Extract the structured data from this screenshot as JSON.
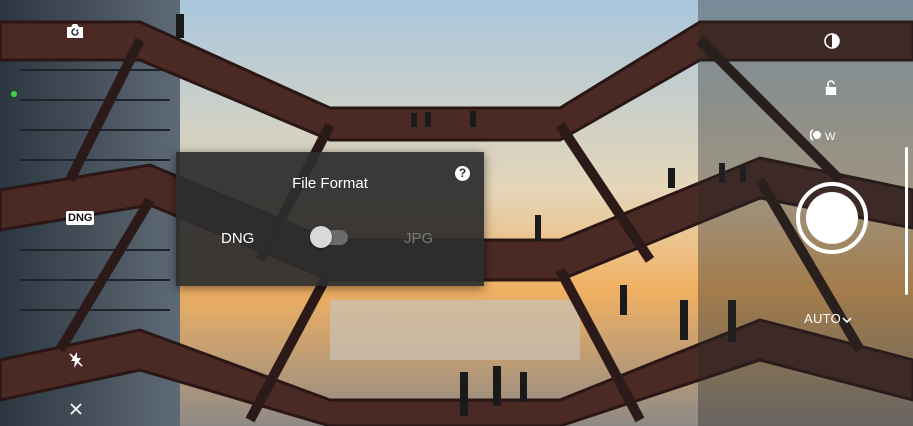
{
  "top_left": {
    "switch_camera_icon": "camera-switch-icon"
  },
  "badges": {
    "format_badge": "DNG"
  },
  "right_controls": {
    "filter_icon": "filter-icon",
    "lock_icon": "unlock-icon",
    "white_balance": {
      "icon": "wb-tungsten-icon",
      "suffix": "W"
    },
    "shutter_icon": "shutter-button",
    "scene_mode_label": "AUTO"
  },
  "bottom_left": {
    "flash_icon": "flash-off-icon",
    "close_icon": "close-icon"
  },
  "dialog": {
    "title": "File Format",
    "help_icon": "help-icon",
    "help_glyph": "?",
    "option_left": "DNG",
    "option_right": "JPG",
    "toggle_value": "DNG"
  },
  "colors": {
    "status_dot": "#3fd24a",
    "dialog_bg": "#2d2d2d",
    "inactive_option": "#7a7a7a"
  }
}
